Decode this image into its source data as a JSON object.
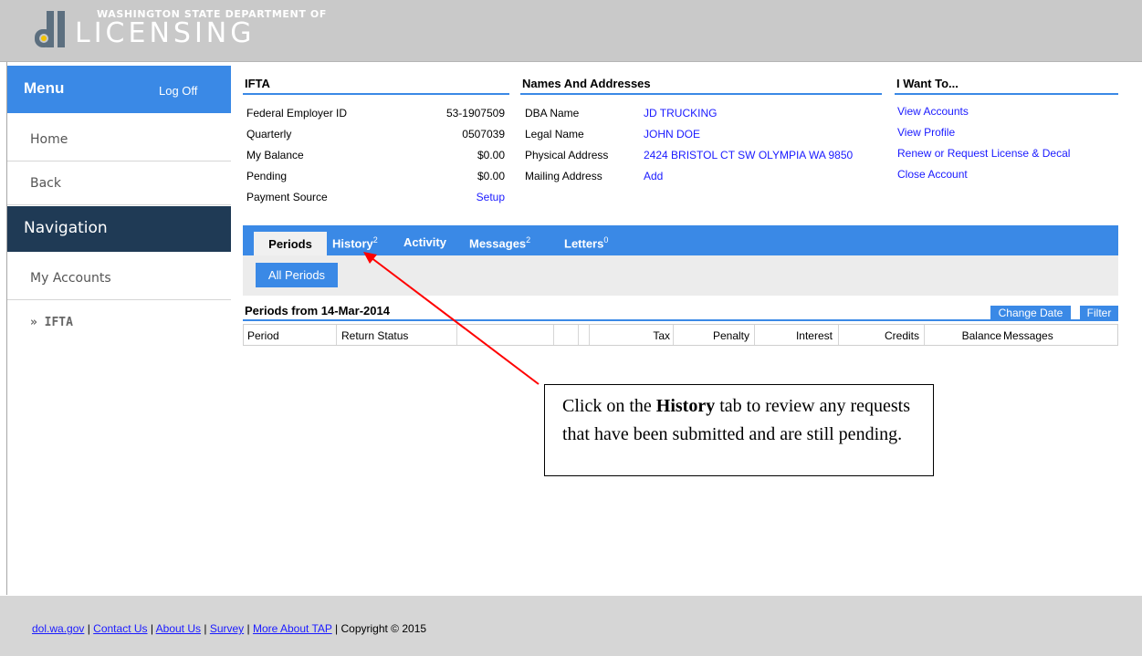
{
  "header": {
    "org_line": "WASHINGTON STATE DEPARTMENT OF",
    "brand": "LICENSING"
  },
  "sidebar": {
    "menu_title": "Menu",
    "logoff": "Log Off",
    "items": [
      {
        "label": "Home"
      },
      {
        "label": "Back"
      }
    ],
    "nav_title": "Navigation",
    "nav_items": [
      {
        "label": "My Accounts"
      },
      {
        "label": "» IFTA"
      }
    ]
  },
  "ifta": {
    "title": "IFTA",
    "rows": [
      {
        "label": "Federal Employer ID",
        "value": "53-1907509"
      },
      {
        "label": "Quarterly",
        "value": "0507039"
      },
      {
        "label": "My Balance",
        "value": "$0.00"
      },
      {
        "label": "Pending",
        "value": "$0.00"
      },
      {
        "label": "Payment Source",
        "value": "Setup"
      }
    ]
  },
  "names": {
    "title": "Names And Addresses",
    "rows": [
      {
        "label": "DBA Name",
        "value": "JD TRUCKING"
      },
      {
        "label": "Legal Name",
        "value": "JOHN DOE"
      },
      {
        "label": "Physical Address",
        "value": "2424 BRISTOL CT SW OLYMPIA WA 9850"
      },
      {
        "label": "Mailing Address",
        "value": "Add"
      }
    ]
  },
  "want": {
    "title": "I Want To...",
    "links": [
      "View Accounts",
      "View Profile",
      "Renew or Request License & Decal",
      "Close Account"
    ]
  },
  "tabs": {
    "active": "Periods",
    "items": [
      {
        "label": "History",
        "count": "2"
      },
      {
        "label": "Activity",
        "count": ""
      },
      {
        "label": "Messages",
        "count": "2"
      },
      {
        "label": "Letters",
        "count": "0"
      }
    ],
    "sub_button": "All Periods"
  },
  "periods": {
    "title": "Periods from 14-Mar-2014",
    "change_date": "Change Date",
    "filter": "Filter",
    "columns": [
      "Period",
      "Return Status",
      "Tax",
      "Penalty",
      "Interest",
      "Credits",
      "Balance",
      "Messages"
    ]
  },
  "callout": {
    "pre": "Click on the ",
    "bold": "History",
    "post": " tab to review any requests that have been submitted and are still pending."
  },
  "footer": {
    "links": [
      "dol.wa.gov",
      "Contact Us",
      "About Us",
      "Survey",
      "More About TAP"
    ],
    "copyright": "Copyright © 2015"
  },
  "colors": {
    "accent": "#3a89e6",
    "nav_dark": "#1f3a55",
    "callout_arrow": "#ff0000"
  }
}
